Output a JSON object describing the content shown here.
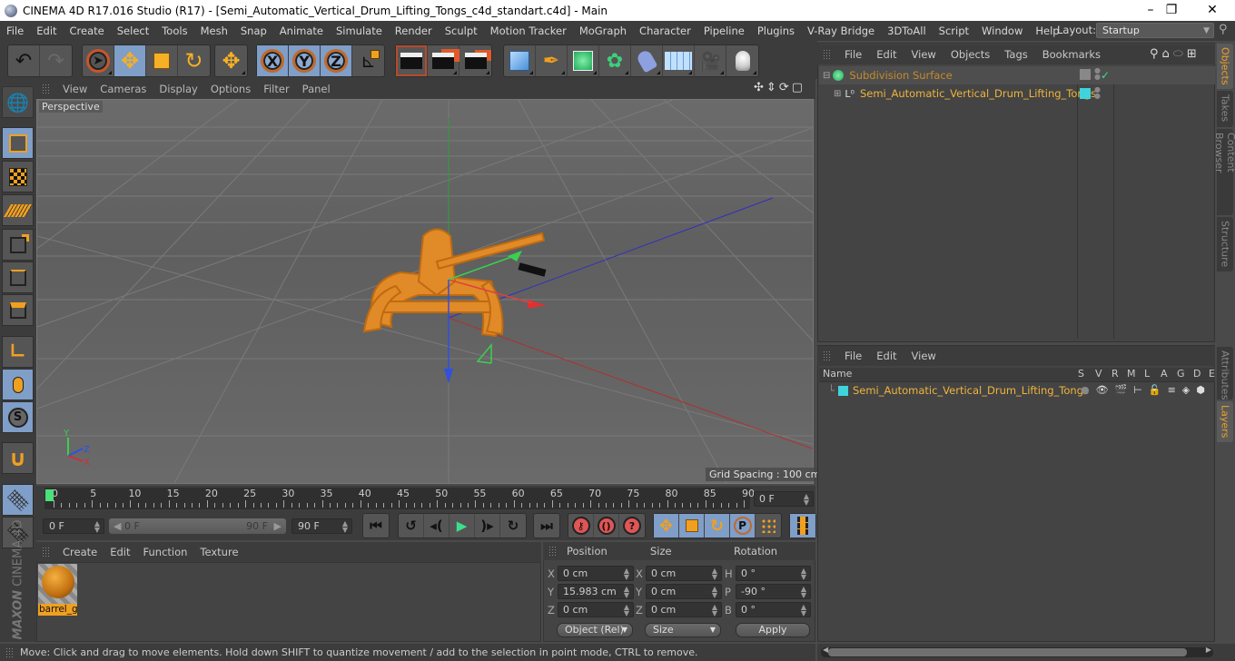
{
  "window": {
    "title": "CINEMA 4D R17.016 Studio (R17) - [Semi_Automatic_Vertical_Drum_Lifting_Tongs_c4d_standart.c4d] - Main",
    "minimize": "–",
    "maximize": "❐",
    "close": "✕"
  },
  "menubar": {
    "items": [
      "File",
      "Edit",
      "Create",
      "Select",
      "Tools",
      "Mesh",
      "Snap",
      "Animate",
      "Simulate",
      "Render",
      "Sculpt",
      "Motion Tracker",
      "MoGraph",
      "Character",
      "Pipeline",
      "Plugins",
      "V-Ray Bridge",
      "3DToAll",
      "Script",
      "Window",
      "Help"
    ],
    "layout_label": "Layout:",
    "layout_value": "Startup"
  },
  "toolbar": {
    "undo": "undo-icon",
    "redo": "redo-icon",
    "tools": [
      "live-selection",
      "move",
      "scale",
      "rotate",
      "last-tool"
    ],
    "axis": [
      "X",
      "Y",
      "Z"
    ],
    "coordinate_system": "world-axis-icon",
    "render": [
      "render-view",
      "render-picture-viewer",
      "render-settings"
    ],
    "create": [
      "cube",
      "pen",
      "subdivision",
      "cloner",
      "bend-deformer",
      "floor",
      "camera",
      "light"
    ]
  },
  "left_palette": [
    "make-editable",
    "model-mode",
    "texture-mode",
    "workplane-mode",
    "points-mode",
    "edges-mode",
    "polygons-mode",
    "axis-mode",
    "tweak-mode",
    "sculpt-mode",
    "snapping",
    "lock-workplane",
    "workplane"
  ],
  "viewport": {
    "menu": [
      "View",
      "Cameras",
      "Display",
      "Options",
      "Filter",
      "Panel"
    ],
    "label": "Perspective",
    "grid_spacing": "Grid Spacing : 100 cm",
    "axis_labels": {
      "x": "X",
      "y": "Y",
      "z": "Z"
    }
  },
  "timeline": {
    "ticks": [
      "0",
      "5",
      "10",
      "15",
      "20",
      "25",
      "30",
      "35",
      "40",
      "45",
      "50",
      "55",
      "60",
      "65",
      "70",
      "75",
      "80",
      "85",
      "90"
    ],
    "current_frame": "0 F",
    "start_field": "0 F",
    "range_start": "0 F",
    "range_end": "90 F",
    "end_field": "90 F"
  },
  "material_manager": {
    "menu": [
      "Create",
      "Edit",
      "Function",
      "Texture"
    ],
    "materials": [
      {
        "name": "barrel_g"
      }
    ]
  },
  "coordinates": {
    "headers": {
      "position": "Position",
      "size": "Size",
      "rotation": "Rotation"
    },
    "rows": [
      {
        "pl": "X",
        "pos": "0 cm",
        "sl": "X",
        "size": "0 cm",
        "rl": "H",
        "rot": "0 °"
      },
      {
        "pl": "Y",
        "pos": "15.983 cm",
        "sl": "Y",
        "size": "0 cm",
        "rl": "P",
        "rot": "-90 °"
      },
      {
        "pl": "Z",
        "pos": "0 cm",
        "sl": "Z",
        "size": "0 cm",
        "rl": "B",
        "rot": "0 °"
      }
    ],
    "mode": "Object (Rel)",
    "size_mode": "Size",
    "apply": "Apply"
  },
  "status": "Move: Click and drag to move elements. Hold down SHIFT to quantize movement / add to the selection in point mode, CTRL to remove.",
  "object_manager": {
    "menu": [
      "File",
      "Edit",
      "View",
      "Objects",
      "Tags",
      "Bookmarks"
    ],
    "objects": [
      {
        "name": "Subdivision Surface",
        "color": "#c68a2a"
      },
      {
        "name": "Semi_Automatic_Vertical_Drum_Lifting_Tongs",
        "color": "#f0b43c",
        "layer_color": "#3fd3dc"
      }
    ]
  },
  "layer_manager": {
    "menu": [
      "File",
      "Edit",
      "View"
    ],
    "columns": [
      "Name",
      "S",
      "V",
      "R",
      "M",
      "L",
      "A",
      "G",
      "D",
      "E"
    ],
    "layers": [
      {
        "name": "Semi_Automatic_Vertical_Drum_Lifting_Tongs",
        "color": "#3fd3dc"
      }
    ]
  },
  "side_tabs": {
    "top": [
      {
        "label": "Objects",
        "active": true
      },
      {
        "label": "Takes",
        "active": false
      },
      {
        "label": "Content Browser",
        "active": false
      },
      {
        "label": "Structure",
        "active": false
      }
    ],
    "bottom": [
      {
        "label": "Attributes",
        "active": false
      },
      {
        "label": "Layers",
        "active": true
      }
    ]
  },
  "brand": {
    "maxon": "MAXON",
    "product": "CINEMA 4D"
  },
  "colors": {
    "accent_orange": "#f0a020",
    "selection_blue": "#7f9ec8",
    "panel_bg": "#444444"
  }
}
